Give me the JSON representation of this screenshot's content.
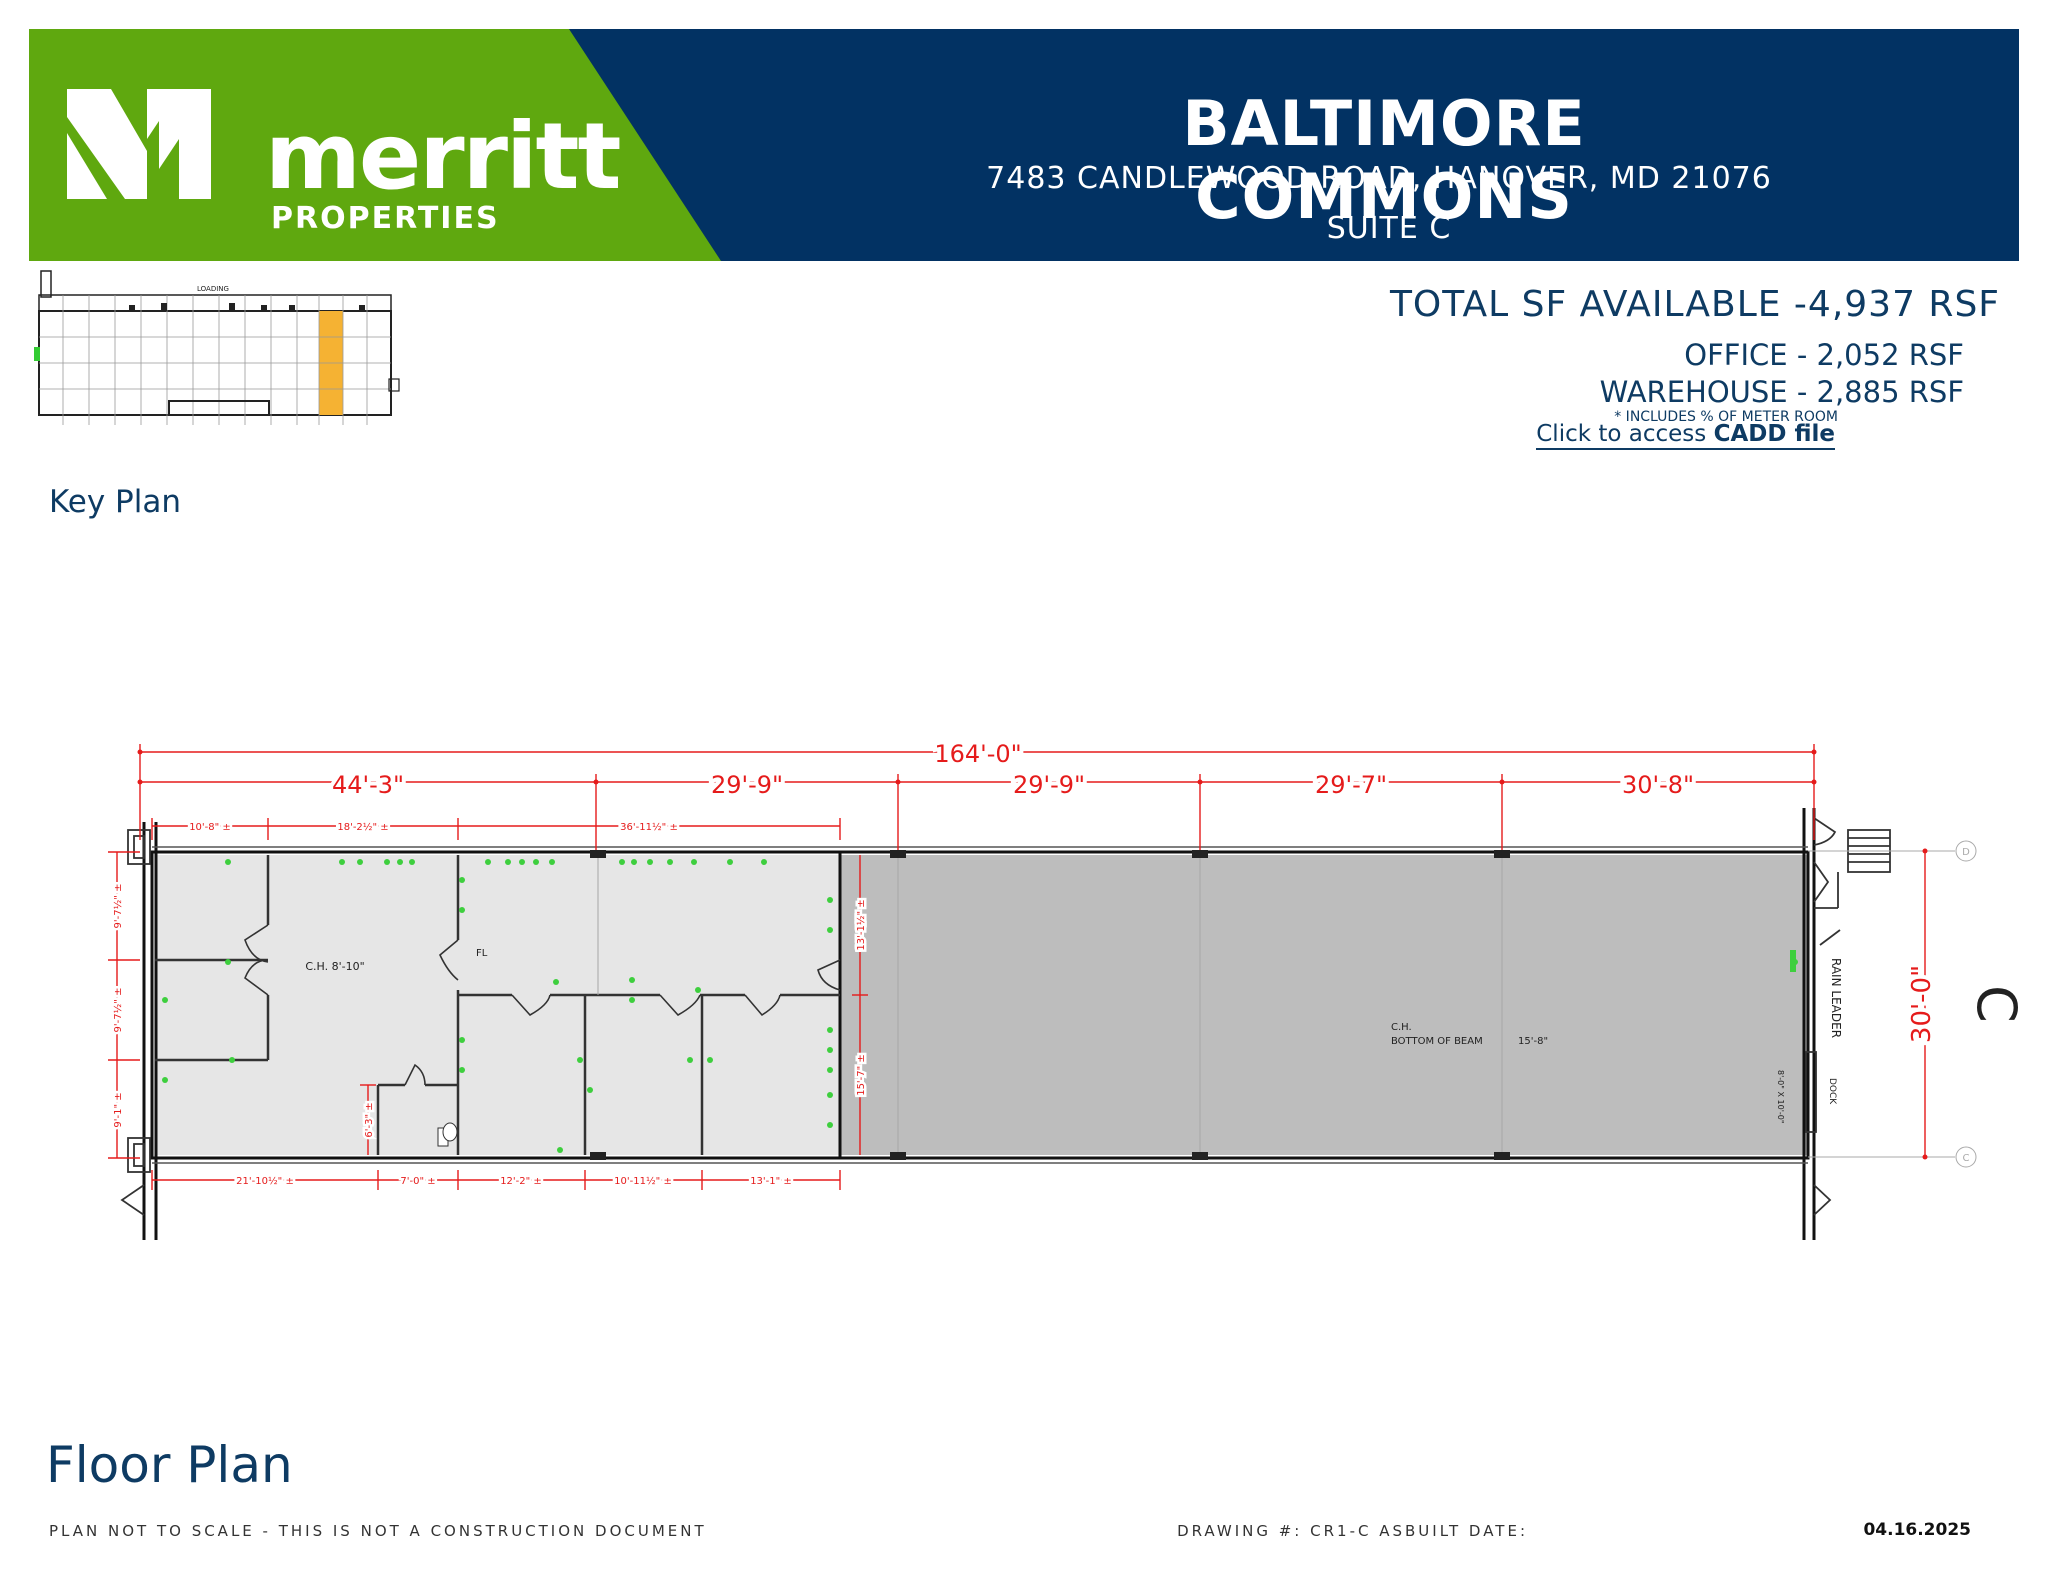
{
  "header": {
    "logo": {
      "brand": "merritt",
      "sub": "PROPERTIES"
    },
    "title": "BALTIMORE COMMONS",
    "address": "7483 CANDLEWOOD ROAD,  HANOVER, MD  21076",
    "suite": "SUITE C",
    "colors": {
      "green": "#5fa80f",
      "navy": "#023263"
    }
  },
  "summary": {
    "total": "TOTAL SF AVAILABLE -4,937 RSF",
    "office": "OFFICE -  2,052 RSF",
    "warehouse": "WAREHOUSE - 2,885 RSF",
    "note": "* INCLUDES % OF METER ROOM",
    "cadd_prefix": "Click to access",
    "cadd_link": "CADD file"
  },
  "key_plan": {
    "label": "Key Plan",
    "loading": "LOADING",
    "highlight_color": "#f5b233"
  },
  "plan": {
    "overall": "164'-0\"",
    "bays": [
      "44'-3\"",
      "29'-9\"",
      "29'-9\"",
      "29'-7\"",
      "30'-8\""
    ],
    "top_dims": [
      "10'-8\" ±",
      "18'-2½\" ±",
      "36'-11½\" ±"
    ],
    "bottom_dims": [
      "21'-10½\" ±",
      "7'-0\" ±",
      "12'-2\" ±",
      "10'-11½\" ±",
      "13'-1\" ±"
    ],
    "left_dims": [
      "9'-7½\" ±",
      "9'-7½\" ±",
      "9'-1\" ±"
    ],
    "right_inner_dims": [
      "13'-1½\" ±",
      "15'-7\" ±"
    ],
    "small_dim": "6'-3\" ±",
    "office_ch": "C.H. 8'-10\"",
    "fl": "FL",
    "warehouse_ch": "C.H.",
    "bottom_of_beam": "BOTTOM OF BEAM",
    "beam_height": "15'-8\"",
    "rain_leader": "RAIN LEADER",
    "dock": "DOCK",
    "dock_size": "8'-0\" X 10'-0\"",
    "height": "30'-0\"",
    "column_line": "C",
    "grid_d": "D",
    "grid_c": "C"
  },
  "footer": {
    "floor_plan": "Floor Plan",
    "disclaimer": "PLAN NOT TO SCALE - THIS IS NOT A CONSTRUCTION DOCUMENT",
    "drawing": "DRAWING #: CR1-C  ASBUILT DATE:",
    "date": "04.16.2025"
  }
}
